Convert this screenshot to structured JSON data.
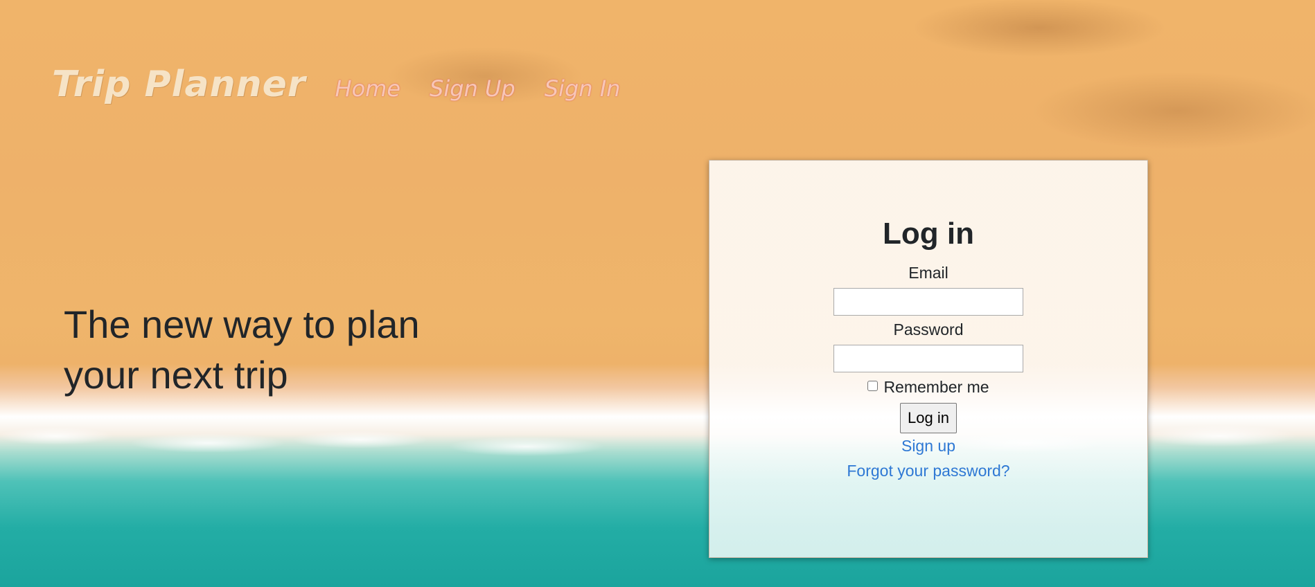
{
  "navbar": {
    "brand": "Trip Planner",
    "links": [
      {
        "label": "Home"
      },
      {
        "label": "Sign Up"
      },
      {
        "label": "Sign In"
      }
    ]
  },
  "hero": {
    "headline": "The new way to plan your next trip"
  },
  "login": {
    "title": "Log in",
    "email_label": "Email",
    "email_value": "",
    "password_label": "Password",
    "password_value": "",
    "remember_label": "Remember me",
    "remember_checked": false,
    "submit_label": "Log in",
    "signup_link": "Sign up",
    "forgot_link": "Forgot your password?"
  },
  "colors": {
    "link": "#2e78d4",
    "nav_link": "#f7c7b8",
    "brand": "#f6e3c6",
    "text": "#212529"
  }
}
